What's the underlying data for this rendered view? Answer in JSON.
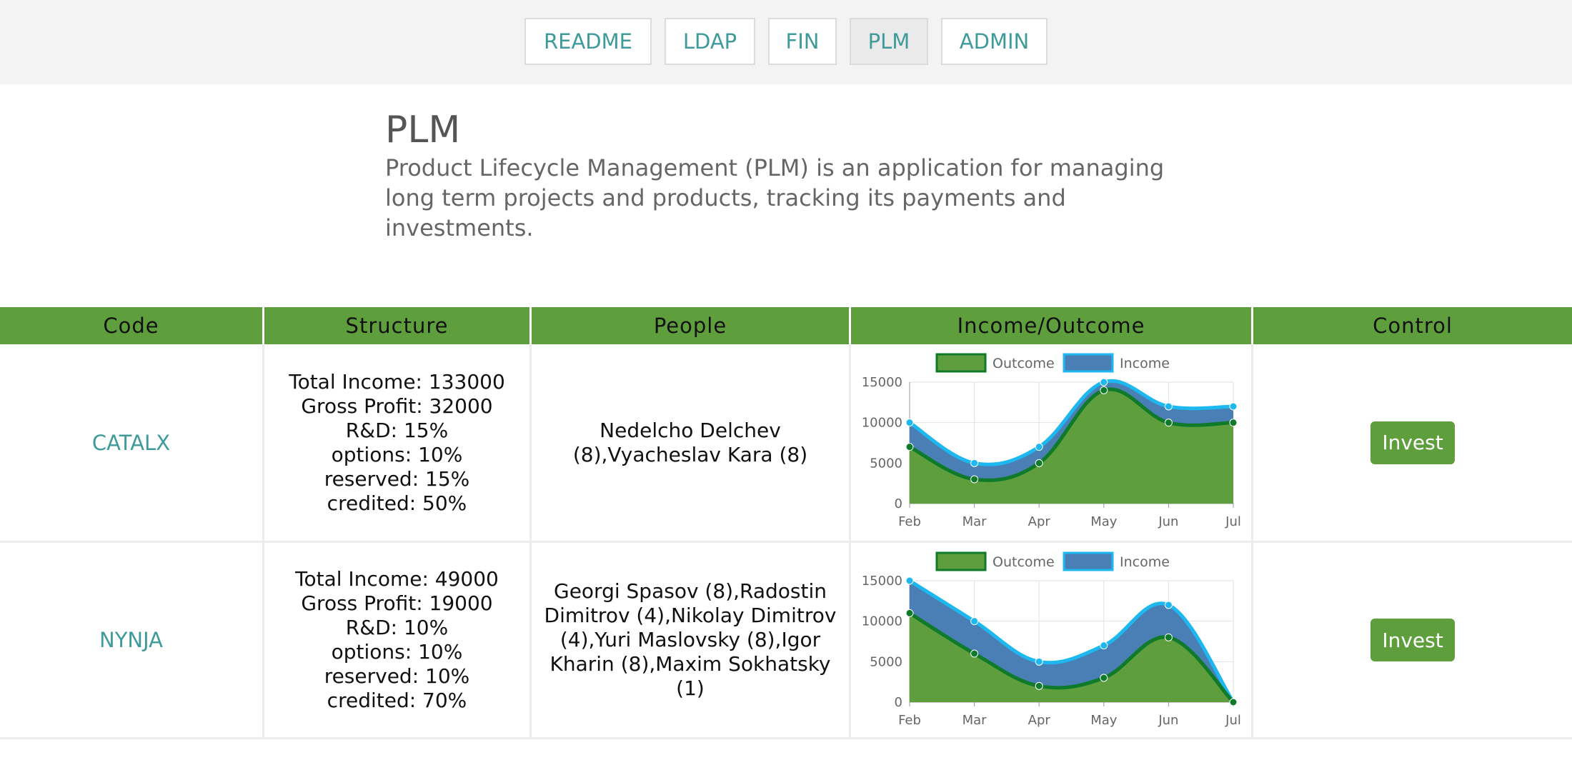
{
  "nav": {
    "items": [
      {
        "label": "README",
        "active": false
      },
      {
        "label": "LDAP",
        "active": false
      },
      {
        "label": "FIN",
        "active": false
      },
      {
        "label": "PLM",
        "active": true
      },
      {
        "label": "ADMIN",
        "active": false
      }
    ]
  },
  "hero": {
    "title": "PLM",
    "description": "Product Lifecycle Management (PLM) is an application for managing long term projects and products, tracking its payments and investments."
  },
  "table": {
    "headers": [
      "Code",
      "Structure",
      "People",
      "Income/Outcome",
      "Control"
    ],
    "rows": [
      {
        "code": "CATALX",
        "structure": [
          "Total Income: 133000",
          "Gross Profit: 32000",
          "R&D: 15%",
          "options: 10%",
          "reserved: 15%",
          "credited: 50%"
        ],
        "people": "Nedelcho Delchev (8),Vyacheslav Kara (8)",
        "control_label": "Invest"
      },
      {
        "code": "NYNJA",
        "structure": [
          "Total Income: 49000",
          "Gross Profit: 19000",
          "R&D: 10%",
          "options: 10%",
          "reserved: 10%",
          "credited: 70%"
        ],
        "people": "Georgi Spasov (8),Radostin Dimitrov (4),Nikolay Dimitrov (4),Yuri Maslovsky (8),Igor Kharin (8),Maxim Sokhatsky (1)",
        "control_label": "Invest"
      }
    ]
  },
  "chart_data": [
    {
      "type": "area",
      "categories": [
        "Feb",
        "Mar",
        "Apr",
        "May",
        "Jun",
        "Jul"
      ],
      "series": [
        {
          "name": "Outcome",
          "values": [
            7000,
            3000,
            5000,
            14000,
            10000,
            10000
          ],
          "color": "#5e9e3d",
          "line_color": "#0e7a2a"
        },
        {
          "name": "Income",
          "values": [
            10000,
            5000,
            7000,
            15000,
            12000,
            12000
          ],
          "color": "#4a7fb5",
          "line_color": "#1eb8f0"
        }
      ],
      "yticks": [
        0,
        5000,
        10000,
        15000
      ],
      "ylim": [
        0,
        15000
      ],
      "legend": "top",
      "grid": true
    },
    {
      "type": "area",
      "categories": [
        "Feb",
        "Mar",
        "Apr",
        "May",
        "Jun",
        "Jul"
      ],
      "series": [
        {
          "name": "Outcome",
          "values": [
            11000,
            6000,
            2000,
            3000,
            8000,
            0
          ],
          "color": "#5e9e3d",
          "line_color": "#0e7a2a"
        },
        {
          "name": "Income",
          "values": [
            15000,
            10000,
            5000,
            7000,
            12000,
            0
          ],
          "color": "#4a7fb5",
          "line_color": "#1eb8f0"
        }
      ],
      "yticks": [
        0,
        5000,
        10000,
        15000
      ],
      "ylim": [
        0,
        15000
      ],
      "legend": "top",
      "grid": true
    }
  ]
}
